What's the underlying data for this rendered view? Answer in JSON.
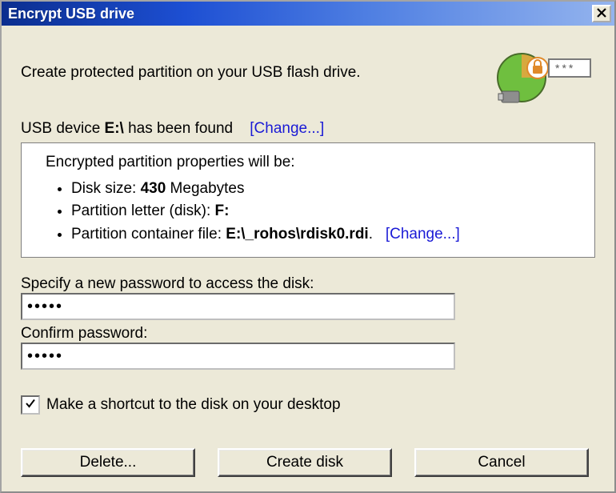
{
  "window": {
    "title": "Encrypt USB drive"
  },
  "intro": "Create protected partition on your USB flash drive.",
  "device": {
    "label": "USB device ",
    "letter": "E:\\",
    "found": " has been found",
    "change": "Change..."
  },
  "props": {
    "heading": "Encrypted partition properties will be:",
    "disk_size_label": "Disk size: ",
    "disk_size_value": "430",
    "disk_size_unit": " Megabytes",
    "partition_letter_label": "Partition letter (disk): ",
    "partition_letter_value": "F:",
    "container_label": "Partition container file: ",
    "container_value": "E:\\_rohos\\rdisk0.rdi",
    "container_dot": ".",
    "change": "Change..."
  },
  "password": {
    "specify": "Specify a new password to access the disk:",
    "confirm": "Confirm password:",
    "value1": "•••••",
    "value2": "•••••"
  },
  "checkbox": {
    "label": "Make a shortcut to the disk on your desktop",
    "checked": true
  },
  "buttons": {
    "delete": "Delete...",
    "create": "Create disk",
    "cancel": "Cancel"
  }
}
